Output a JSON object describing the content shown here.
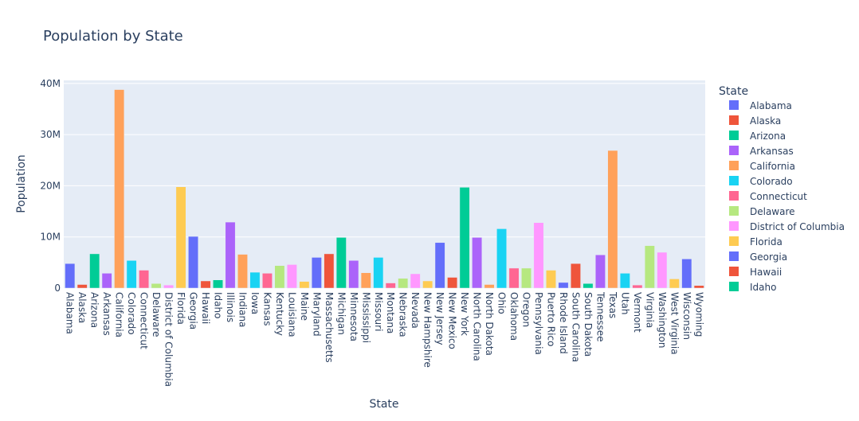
{
  "chart_data": {
    "type": "bar",
    "title": "Population by State",
    "xlabel": "State",
    "ylabel": "Population",
    "ylim": [
      0,
      40600000
    ],
    "yticks": [
      {
        "v": 0,
        "label": "0"
      },
      {
        "v": 10000000,
        "label": "10M"
      },
      {
        "v": 20000000,
        "label": "20M"
      },
      {
        "v": 30000000,
        "label": "30M"
      },
      {
        "v": 40000000,
        "label": "40M"
      }
    ],
    "grid": true,
    "legend": {
      "title": "State",
      "placement": "right"
    },
    "colors": [
      "#636efa",
      "#EF553B",
      "#00cc96",
      "#ab63fa",
      "#FFA15A",
      "#19d3f3",
      "#FF6692",
      "#B6E880",
      "#FF97FF",
      "#FECB52"
    ],
    "categories": [
      "Alabama",
      "Alaska",
      "Arizona",
      "Arkansas",
      "California",
      "Colorado",
      "Connecticut",
      "Delaware",
      "District of Columbia",
      "Florida",
      "Georgia",
      "Hawaii",
      "Idaho",
      "Illinois",
      "Indiana",
      "Iowa",
      "Kansas",
      "Kentucky",
      "Louisiana",
      "Maine",
      "Maryland",
      "Massachusetts",
      "Michigan",
      "Minnesota",
      "Mississippi",
      "Missouri",
      "Montana",
      "Nebraska",
      "Nevada",
      "New Hampshire",
      "New Jersey",
      "New Mexico",
      "New York",
      "North Carolina",
      "North Dakota",
      "Ohio",
      "Oklahoma",
      "Oregon",
      "Pennsylvania",
      "Puerto Rico",
      "Rhode Island",
      "South Carolina",
      "South Dakota",
      "Tennessee",
      "Texas",
      "Utah",
      "Vermont",
      "Virginia",
      "Washington",
      "West Virginia",
      "Wisconsin",
      "Wyoming"
    ],
    "values": [
      4800000,
      700000,
      6700000,
      2900000,
      38800000,
      5400000,
      3500000,
      900000,
      600000,
      19800000,
      10100000,
      1400000,
      1600000,
      12900000,
      6600000,
      3100000,
      2900000,
      4400000,
      4600000,
      1300000,
      6000000,
      6700000,
      9900000,
      5400000,
      3000000,
      6000000,
      1000000,
      1900000,
      2800000,
      1400000,
      8900000,
      2100000,
      19700000,
      9900000,
      700000,
      11600000,
      3900000,
      3900000,
      12800000,
      3500000,
      1100000,
      4800000,
      900000,
      6500000,
      26900000,
      2900000,
      600000,
      8300000,
      7000000,
      1800000,
      5700000,
      500000
    ]
  }
}
